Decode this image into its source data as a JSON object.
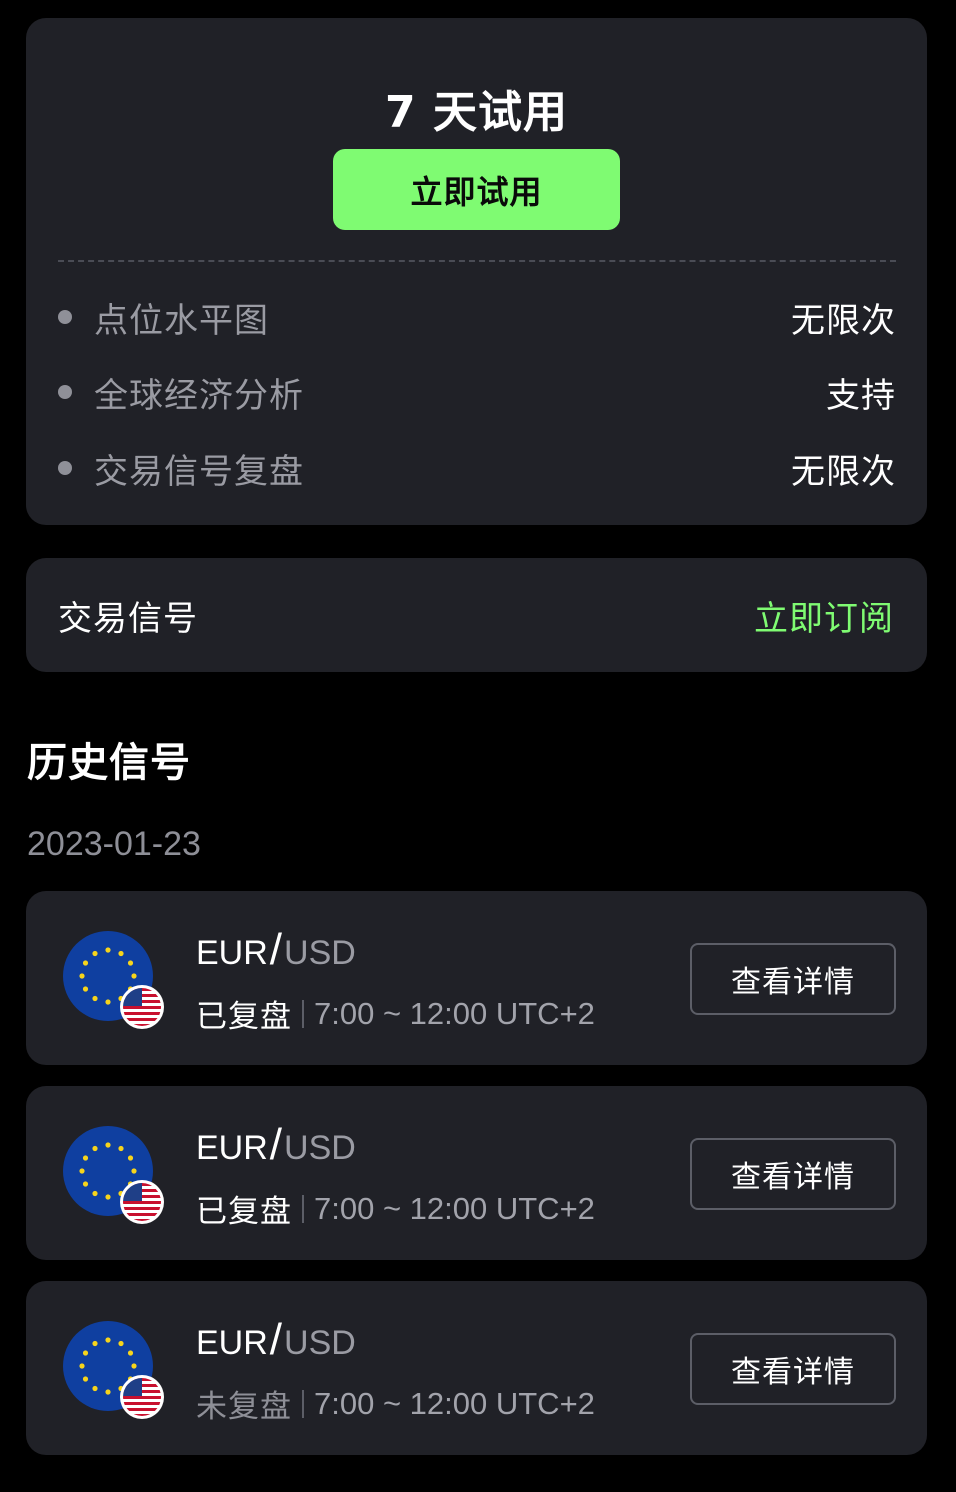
{
  "trial": {
    "title": "7 天试用",
    "button_label": "立即试用",
    "features": [
      {
        "label": "点位水平图",
        "value": "无限次"
      },
      {
        "label": "全球经济分析",
        "value": "支持"
      },
      {
        "label": "交易信号复盘",
        "value": "无限次"
      }
    ]
  },
  "subscription": {
    "label": "交易信号",
    "action": "立即订阅"
  },
  "history": {
    "title": "历史信号",
    "date": "2023-01-23",
    "signals": [
      {
        "base": "EUR",
        "slash": "/",
        "quote": "USD",
        "status": "已复盘",
        "time": "7:00 ~ 12:00 UTC+2",
        "button": "查看详情"
      },
      {
        "base": "EUR",
        "slash": "/",
        "quote": "USD",
        "status": "已复盘",
        "time": "7:00 ~ 12:00 UTC+2",
        "button": "查看详情"
      },
      {
        "base": "EUR",
        "slash": "/",
        "quote": "USD",
        "status": "未复盘",
        "time": "7:00 ~ 12:00 UTC+2",
        "button": "查看详情"
      }
    ]
  },
  "colors": {
    "accent": "#7ffb72",
    "card": "#202127",
    "background": "#000000"
  },
  "icons": {
    "base_flag": "eu-flag-icon",
    "quote_flag": "us-flag-icon"
  }
}
